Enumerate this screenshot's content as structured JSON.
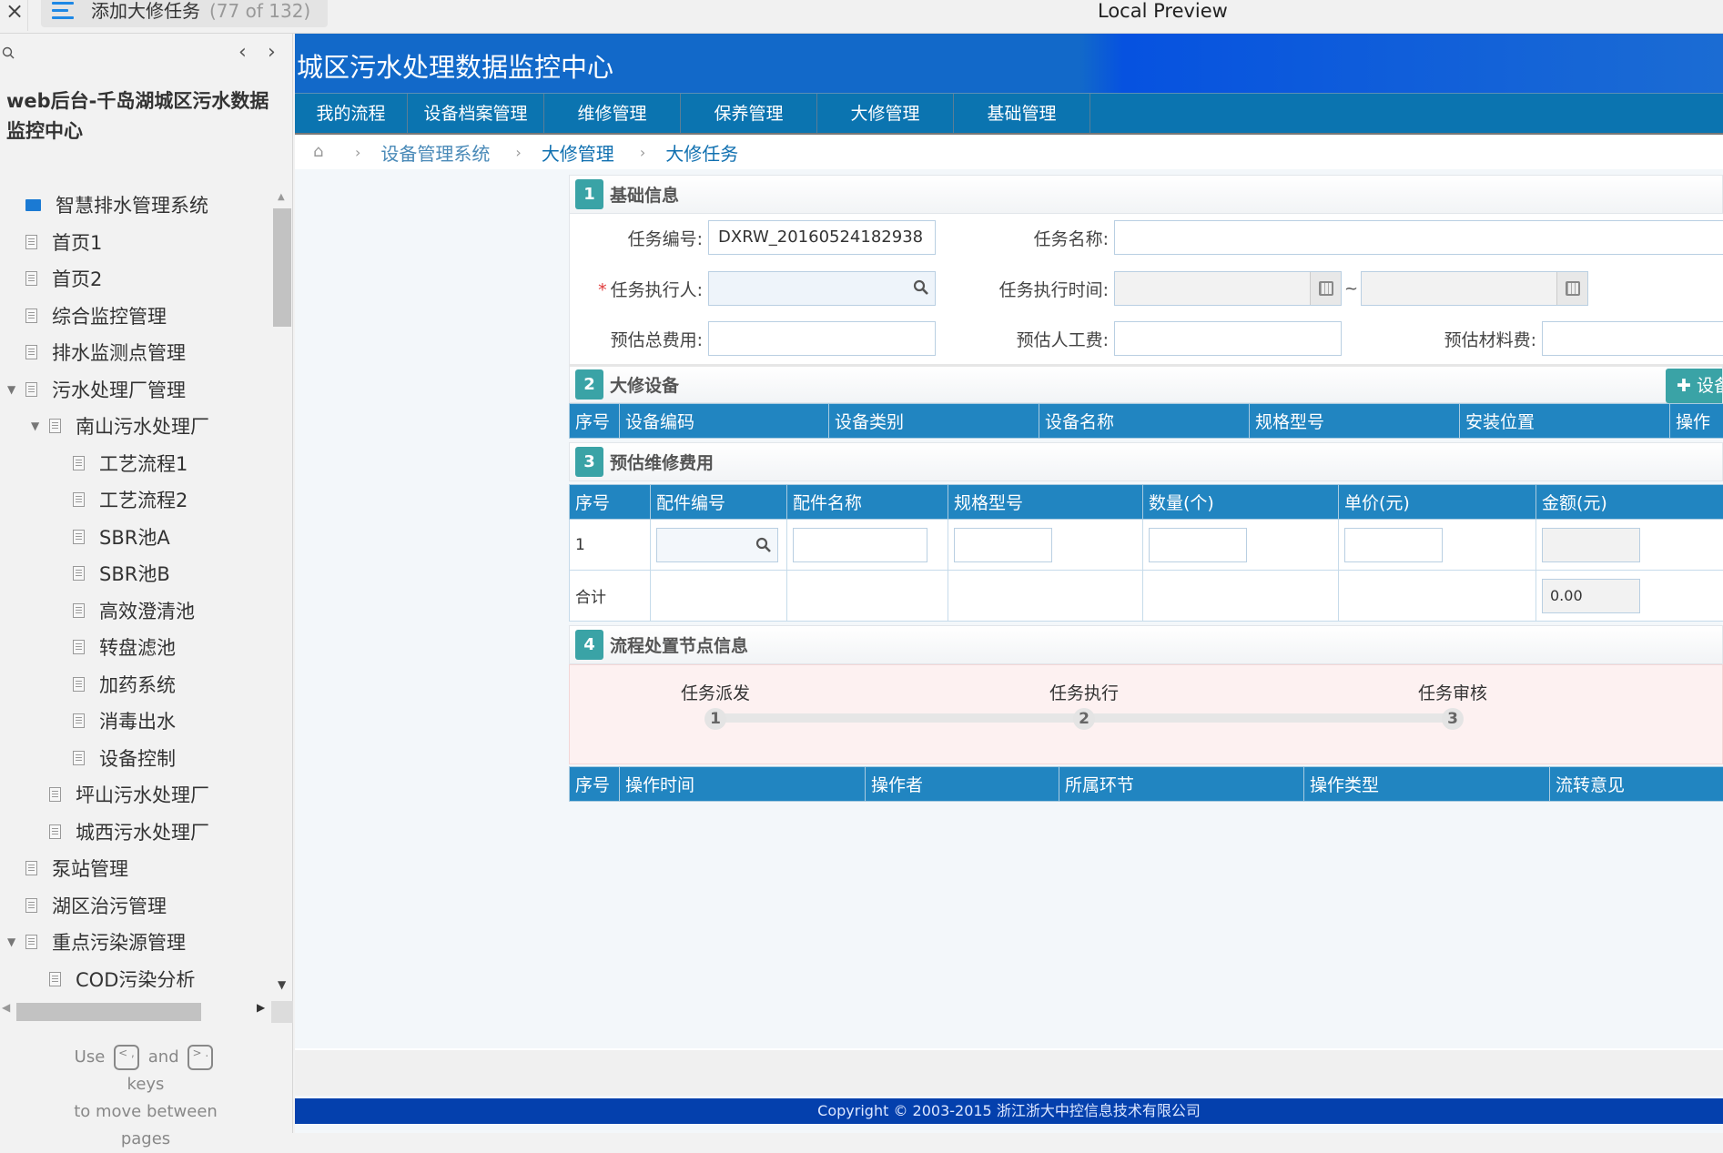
{
  "viewer": {
    "close_label": "×",
    "page_title": "添加大修任务",
    "page_count": "(77 of 132)",
    "app_title": "Local Preview"
  },
  "sidebar": {
    "prev_label": "‹",
    "next_label": "›",
    "doc_title": "web后台-千岛湖城区污水数据监控中心",
    "tree": [
      {
        "label": "智慧排水管理系统",
        "level": 0,
        "icon": "folder-icon",
        "caret": ""
      },
      {
        "label": "首页1",
        "level": 0,
        "icon": "doc-icon",
        "caret": ""
      },
      {
        "label": "首页2",
        "level": 0,
        "icon": "doc-icon",
        "caret": ""
      },
      {
        "label": "综合监控管理",
        "level": 0,
        "icon": "doc-icon",
        "caret": ""
      },
      {
        "label": "排水监测点管理",
        "level": 0,
        "icon": "doc-icon",
        "caret": ""
      },
      {
        "label": "污水处理厂管理",
        "level": 0,
        "icon": "doc-icon",
        "caret": "▼"
      },
      {
        "label": "南山污水处理厂",
        "level": 1,
        "icon": "doc-icon",
        "caret": "▼"
      },
      {
        "label": "工艺流程1",
        "level": 2,
        "icon": "doc-icon",
        "caret": ""
      },
      {
        "label": "工艺流程2",
        "level": 2,
        "icon": "doc-icon",
        "caret": ""
      },
      {
        "label": "SBR池A",
        "level": 2,
        "icon": "doc-icon",
        "caret": ""
      },
      {
        "label": "SBR池B",
        "level": 2,
        "icon": "doc-icon",
        "caret": ""
      },
      {
        "label": "高效澄清池",
        "level": 2,
        "icon": "doc-icon",
        "caret": ""
      },
      {
        "label": "转盘滤池",
        "level": 2,
        "icon": "doc-icon",
        "caret": ""
      },
      {
        "label": "加药系统",
        "level": 2,
        "icon": "doc-icon",
        "caret": ""
      },
      {
        "label": "消毒出水",
        "level": 2,
        "icon": "doc-icon",
        "caret": ""
      },
      {
        "label": "设备控制",
        "level": 2,
        "icon": "doc-icon",
        "caret": ""
      },
      {
        "label": "坪山污水处理厂",
        "level": 1,
        "icon": "doc-icon",
        "caret": ""
      },
      {
        "label": "城西污水处理厂",
        "level": 1,
        "icon": "doc-icon",
        "caret": ""
      },
      {
        "label": "泵站管理",
        "level": 0,
        "icon": "doc-icon",
        "caret": ""
      },
      {
        "label": "湖区治污管理",
        "level": 0,
        "icon": "doc-icon",
        "caret": ""
      },
      {
        "label": "重点污染源管理",
        "level": 0,
        "icon": "doc-icon",
        "caret": "▼"
      },
      {
        "label": "COD污染分析",
        "level": 1,
        "icon": "doc-icon",
        "caret": ""
      }
    ],
    "hint": {
      "use": "Use",
      "key1": "< ,",
      "and": "and",
      "key2": "> .",
      "keys": "keys",
      "line2": "to move between",
      "line3": "pages"
    }
  },
  "header": {
    "title": "城区污水处理数据监控中心"
  },
  "nav": {
    "items": [
      "我的流程",
      "设备档案管理",
      "维修管理",
      "保养管理",
      "大修管理",
      "基础管理"
    ]
  },
  "breadcrumb": {
    "items": [
      "设备管理系统",
      "大修管理",
      "大修任务"
    ]
  },
  "sections": {
    "basic": {
      "num": "1",
      "title": "基础信息",
      "task_no_label": "任务编号:",
      "task_no_value": "DXRW_20160524182938",
      "task_name_label": "任务名称:",
      "task_name_value": "",
      "required_mark": "*",
      "executor_label": "任务执行人:",
      "executor_value": "",
      "exec_time_label": "任务执行时间:",
      "exec_time_start": "",
      "exec_time_end": "",
      "range_sep": "~",
      "total_cost_label": "预估总费用:",
      "labor_cost_label": "预估人工费:",
      "material_cost_label": "预估材料费:"
    },
    "equipment": {
      "num": "2",
      "title": "大修设备",
      "add_button": "✚ 设备",
      "columns": [
        "序号",
        "设备编码",
        "设备类别",
        "设备名称",
        "规格型号",
        "安装位置",
        "操作"
      ]
    },
    "cost": {
      "num": "3",
      "title": "预估维修费用",
      "columns": [
        "序号",
        "配件编号",
        "配件名称",
        "规格型号",
        "数量(个)",
        "单价(元)",
        "金额(元)"
      ],
      "rows": [
        {
          "index": "1",
          "part_no": "",
          "part_name": "",
          "spec": "",
          "qty": "",
          "price": "",
          "amount": ""
        }
      ],
      "total_label": "合计",
      "total_amount": "0.00"
    },
    "flow": {
      "num": "4",
      "title": "流程处置节点信息",
      "steps": [
        {
          "label": "任务派发",
          "num": "1"
        },
        {
          "label": "任务执行",
          "num": "2"
        },
        {
          "label": "任务审核",
          "num": "3"
        }
      ],
      "columns": [
        "序号",
        "操作时间",
        "操作者",
        "所属环节",
        "操作类型",
        "流转意见"
      ]
    }
  },
  "footer": {
    "copyright": "Copyright © 2003-2015 浙江浙大中控信息技术有限公司"
  },
  "colors": {
    "header_blue": "#1269c9",
    "nav_blue": "#0b74b0",
    "table_header": "#2185c1",
    "section_badge": "#3aa3a6",
    "footer_blue": "#0440ad",
    "required": "#e03b3b"
  }
}
